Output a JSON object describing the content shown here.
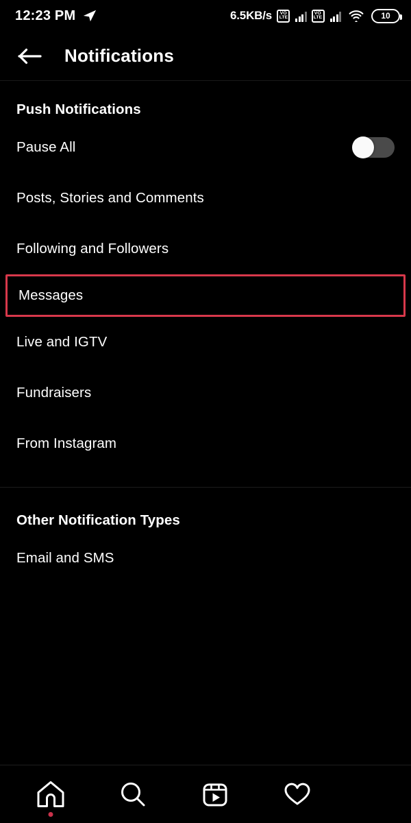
{
  "statusbar": {
    "time": "12:23 PM",
    "send_icon": "telegram-send-icon",
    "network_speed": "6.5KB/s",
    "sim1_label_top": "VO",
    "sim1_label_bottom": "LTE",
    "sim2_label_top": "VO",
    "sim2_label_bottom": "LTE",
    "wifi_icon": "wifi-icon",
    "battery_percent": "10"
  },
  "appbar": {
    "back_icon": "back-arrow-icon",
    "title": "Notifications"
  },
  "sections": [
    {
      "title": "Push Notifications",
      "rows": [
        {
          "label": "Pause All",
          "control": "toggle",
          "toggle_on": false
        },
        {
          "label": "Posts, Stories and Comments",
          "control": "none"
        },
        {
          "label": "Following and Followers",
          "control": "none"
        },
        {
          "label": "Messages",
          "control": "none",
          "highlighted": true
        },
        {
          "label": "Live and IGTV",
          "control": "none"
        },
        {
          "label": "Fundraisers",
          "control": "none"
        },
        {
          "label": "From Instagram",
          "control": "none"
        }
      ]
    },
    {
      "title": "Other Notification Types",
      "rows": [
        {
          "label": "Email and SMS",
          "control": "none"
        }
      ]
    }
  ],
  "bottomnav": {
    "items": [
      {
        "icon": "home-icon",
        "badge": true
      },
      {
        "icon": "search-icon",
        "badge": false
      },
      {
        "icon": "reels-icon",
        "badge": false
      },
      {
        "icon": "heart-icon",
        "badge": false
      }
    ]
  },
  "colors": {
    "background": "#000000",
    "text": "#ffffff",
    "highlight_border": "#d8384b",
    "toggle_track": "#4a4a4a",
    "toggle_knob": "#fafafa",
    "badge_dot": "#c9324b"
  }
}
